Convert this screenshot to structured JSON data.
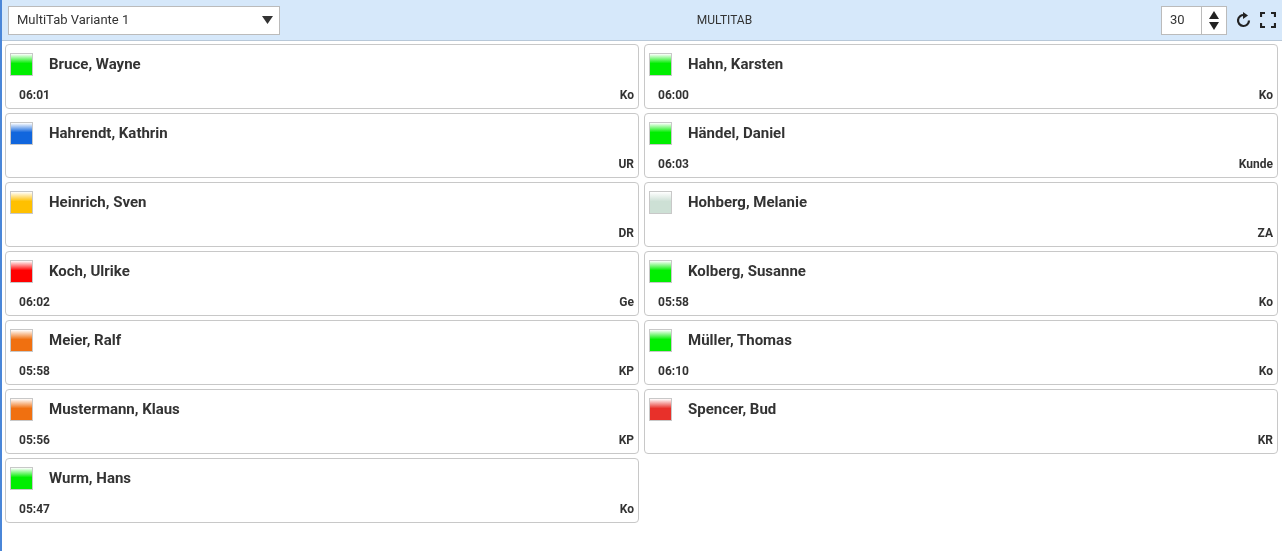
{
  "header": {
    "view_select": {
      "value": "MultiTab Variante 1"
    },
    "title": "MULTITAB",
    "interval": {
      "value": "30"
    }
  },
  "cards": [
    {
      "name": "Bruce, Wayne",
      "time": "06:01",
      "code": "Ko",
      "color": "#00ee00"
    },
    {
      "name": "Hahn, Karsten",
      "time": "06:00",
      "code": "Ko",
      "color": "#00ee00"
    },
    {
      "name": "Hahrendt, Kathrin",
      "code": "UR",
      "color": "#1166dd"
    },
    {
      "name": "Händel, Daniel",
      "time": "06:03",
      "code": "Kunde",
      "color": "#00ee00"
    },
    {
      "name": "Heinrich, Sven",
      "code": "DR",
      "color": "#ffc000"
    },
    {
      "name": "Hohberg, Melanie",
      "code": "ZA",
      "color": "#cde0d5"
    },
    {
      "name": "Koch, Ulrike",
      "time": "06:02",
      "code": "Ge",
      "color": "#ff0000"
    },
    {
      "name": "Kolberg, Susanne",
      "time": "05:58",
      "code": "Ko",
      "color": "#00ee00"
    },
    {
      "name": "Meier, Ralf",
      "time": "05:58",
      "code": "KP",
      "color": "#f07010"
    },
    {
      "name": "Müller, Thomas",
      "time": "06:10",
      "code": "Ko",
      "color": "#00ee00"
    },
    {
      "name": "Mustermann, Klaus",
      "time": "05:56",
      "code": "KP",
      "color": "#f07010"
    },
    {
      "name": "Spencer, Bud",
      "code": "KR",
      "color": "#e8302a"
    },
    {
      "name": "Wurm, Hans",
      "time": "05:47",
      "code": "Ko",
      "color": "#00ee00"
    }
  ]
}
